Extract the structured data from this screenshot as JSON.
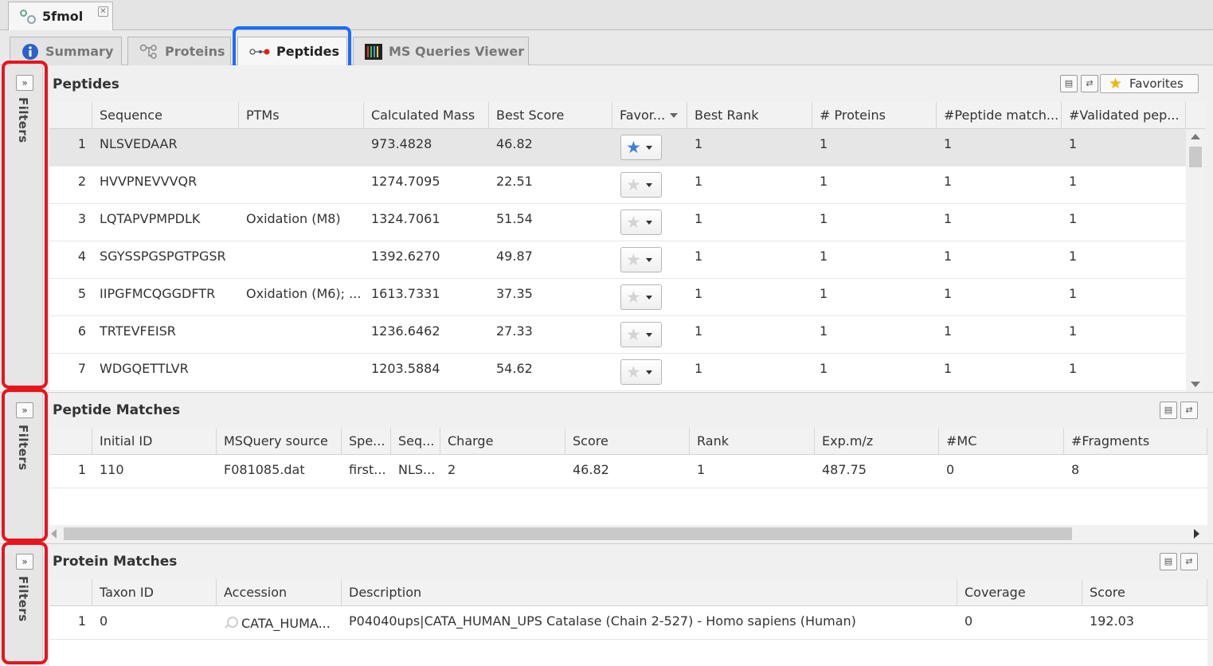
{
  "document_tab": {
    "title": "5fmol",
    "close": "✕"
  },
  "view_tabs": [
    {
      "label": "Summary"
    },
    {
      "label": "Proteins"
    },
    {
      "label": "Peptides"
    },
    {
      "label": "MS Queries Viewer"
    }
  ],
  "filters_label": "Filters",
  "expand_glyph": "»",
  "peptides": {
    "title": "Peptides",
    "favorites_label": "Favorites",
    "columns": [
      "",
      "Sequence",
      "PTMs",
      "Calculated Mass",
      "Best Score",
      "Favor...",
      "Best Rank",
      "# Proteins",
      "#Peptide match...",
      "#Validated pep..."
    ],
    "rows": [
      {
        "n": "1",
        "sequence": "NLSVEDAAR",
        "ptms": "",
        "mass": "973.4828",
        "score": "46.82",
        "favorite": true,
        "rank": "1",
        "proteins": "1",
        "pep_match": "1",
        "validated": "1"
      },
      {
        "n": "2",
        "sequence": "HVVPNEVVVQR",
        "ptms": "",
        "mass": "1274.7095",
        "score": "22.51",
        "favorite": false,
        "rank": "1",
        "proteins": "1",
        "pep_match": "1",
        "validated": "1"
      },
      {
        "n": "3",
        "sequence": "LQTAPVPMPDLK",
        "ptms": "Oxidation (M8)",
        "mass": "1324.7061",
        "score": "51.54",
        "favorite": false,
        "rank": "1",
        "proteins": "1",
        "pep_match": "1",
        "validated": "1"
      },
      {
        "n": "4",
        "sequence": "SGYSSPGSPGTPGSR",
        "ptms": "",
        "mass": "1392.6270",
        "score": "49.87",
        "favorite": false,
        "rank": "1",
        "proteins": "1",
        "pep_match": "1",
        "validated": "1"
      },
      {
        "n": "5",
        "sequence": "IIPGFMCQGGDFTR",
        "ptms": "Oxidation (M6); ...",
        "mass": "1613.7331",
        "score": "37.35",
        "favorite": false,
        "rank": "1",
        "proteins": "1",
        "pep_match": "1",
        "validated": "1"
      },
      {
        "n": "6",
        "sequence": "TRTEVFEISR",
        "ptms": "",
        "mass": "1236.6462",
        "score": "27.33",
        "favorite": false,
        "rank": "1",
        "proteins": "1",
        "pep_match": "1",
        "validated": "1"
      },
      {
        "n": "7",
        "sequence": "WDGQETTLVR",
        "ptms": "",
        "mass": "1203.5884",
        "score": "54.62",
        "favorite": false,
        "rank": "1",
        "proteins": "1",
        "pep_match": "1",
        "validated": "1"
      }
    ]
  },
  "peptide_matches": {
    "title": "Peptide Matches",
    "columns": [
      "",
      "Initial ID",
      "MSQuery source",
      "Spe...",
      "Seq...",
      "Charge",
      "Score",
      "Rank",
      "Exp.m/z",
      "#MC",
      "#Fragments"
    ],
    "rows": [
      {
        "n": "1",
        "initial_id": "110",
        "source": "F081085.dat",
        "spe": "first...",
        "seq": "NLS...",
        "charge": "2",
        "score": "46.82",
        "rank": "1",
        "expmz": "487.75",
        "mc": "0",
        "fragments": "8"
      }
    ]
  },
  "protein_matches": {
    "title": "Protein Matches",
    "columns": [
      "",
      "Taxon ID",
      "Accession",
      "Description",
      "Coverage",
      "Score"
    ],
    "rows": [
      {
        "n": "1",
        "taxon": "0",
        "accession": "CATA_HUMA...",
        "description": "P04040ups|CATA_HUMAN_UPS Catalase (Chain 2-527) - Homo sapiens (Human)",
        "coverage": "0",
        "score": "192.03"
      }
    ]
  },
  "colors": {
    "highlight_blue": "#1a6cff",
    "highlight_red": "#e8141c",
    "favorite_star": "#3f7de0",
    "favorites_star": "#f2b400"
  }
}
